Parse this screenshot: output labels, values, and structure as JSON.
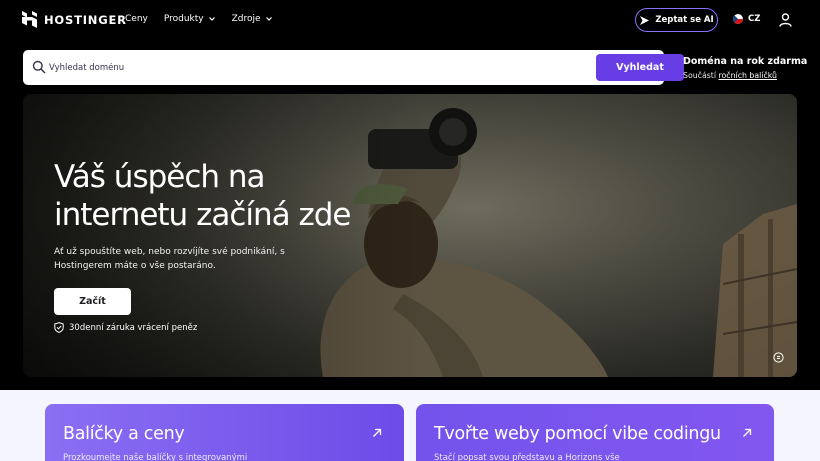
{
  "header": {
    "logo_text": "HOSTINGER",
    "nav": [
      {
        "label": "Ceny",
        "has_dropdown": false
      },
      {
        "label": "Produkty",
        "has_dropdown": true
      },
      {
        "label": "Zdroje",
        "has_dropdown": true
      }
    ],
    "ask_ai_label": "Zeptat se AI",
    "language": "CZ",
    "icons": {
      "ask_ai": "sparkle-icon",
      "language": "czech-flag-icon",
      "account": "user-icon"
    }
  },
  "search": {
    "placeholder": "Vyhledat doménu",
    "button_label": "Vyhledat",
    "icon": "search-icon"
  },
  "promo": {
    "title": "Doména na rok zdarma",
    "sub_prefix": "Součástí",
    "sub_link": "ročních balíčků"
  },
  "hero": {
    "title": "Váš úspěch na internetu začíná zde",
    "subtitle": "Ať už spouštíte web, nebo rozvíjíte své podnikání, s Hostingerem máte o vše postaráno.",
    "cta_label": "Začít",
    "guarantee": "30denní záruka vrácení peněz",
    "icons": {
      "guarantee": "shield-check-icon",
      "media_control": "pause-icon"
    }
  },
  "cards": [
    {
      "title": "Balíčky a ceny",
      "description": "Prozkoumejte naše balíčky s integrovanými",
      "icon": "arrow-up-right-icon"
    },
    {
      "title": "Tvořte weby pomocí vibe codingu",
      "description": "Stačí popsat svou představu a Horizons vše",
      "icon": "arrow-up-right-icon"
    }
  ],
  "colors": {
    "brand_purple": "#673de6",
    "page_background": "#000000",
    "section_background": "#f4f5ff"
  }
}
